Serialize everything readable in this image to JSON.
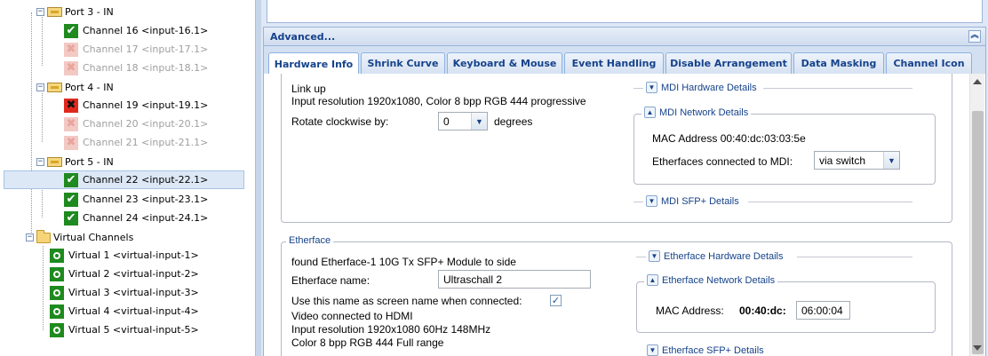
{
  "tree": {
    "ports": [
      {
        "label": "Port 3 - IN",
        "channels": [
          {
            "label": "Channel 16  <input-16.1>",
            "status": "ok"
          },
          {
            "label": "Channel 17  <input-17.1>",
            "status": "off"
          },
          {
            "label": "Channel 18  <input-18.1>",
            "status": "off"
          }
        ]
      },
      {
        "label": "Port 4 - IN",
        "channels": [
          {
            "label": "Channel 19  <input-19.1>",
            "status": "error"
          },
          {
            "label": "Channel 20  <input-20.1>",
            "status": "off"
          },
          {
            "label": "Channel 21  <input-21.1>",
            "status": "off"
          }
        ]
      },
      {
        "label": "Port 5 - IN",
        "channels": [
          {
            "label": "Channel 22  <input-22.1>",
            "status": "ok",
            "selected": true
          },
          {
            "label": "Channel 23  <input-23.1>",
            "status": "ok"
          },
          {
            "label": "Channel 24  <input-24.1>",
            "status": "ok"
          }
        ]
      }
    ],
    "virtual_folder": "Virtual Channels",
    "virtual_items": [
      "Virtual 1  <virtual-input-1>",
      "Virtual 2  <virtual-input-2>",
      "Virtual 3  <virtual-input-3>",
      "Virtual 4  <virtual-input-4>",
      "Virtual 5  <virtual-input-5>"
    ]
  },
  "advanced": {
    "title": "Advanced...",
    "tabs": [
      "Hardware Info",
      "Shrink Curve",
      "Keyboard & Mouse",
      "Event Handling",
      "Disable Arrangement",
      "Data Masking",
      "Channel Icon"
    ],
    "active_tab": "Hardware Info"
  },
  "hardware": {
    "link_status": "Link up",
    "input_resolution": "Input resolution 1920x1080, Color 8 bpp RGB 444 progressive",
    "rotate_label": "Rotate clockwise by:",
    "rotate_value": "0",
    "rotate_unit": "degrees",
    "mdi_hardware_title": "MDI Hardware Details",
    "mdi_network_title": "MDI Network Details",
    "mac_address": "MAC Address 00:40:dc:03:03:5e",
    "etherfaces_label": "Etherfaces connected to MDI:",
    "etherfaces_value": "via switch",
    "mdi_sfp_title": "MDI SFP+ Details"
  },
  "etherface": {
    "legend": "Etherface",
    "found": "found Etherface-1 10G Tx SFP+ Module to side",
    "name_label": "Etherface name:",
    "name_value": "Ultraschall 2",
    "use_name_label": "Use this name as screen name when connected:",
    "use_name_checked": true,
    "video_connected": "Video connected to HDMI",
    "input_resolution": "Input resolution 1920x1080 60Hz 148MHz",
    "color": "Color 8 bpp RGB 444 Full range",
    "hw_title": "Etherface Hardware Details",
    "net_title": "Etherface Network Details",
    "mac_label": "MAC Address:",
    "mac_prefix": "00:40:dc:",
    "mac_suffix": "06:00:04",
    "sfp_title": "Etherface SFP+ Details"
  },
  "colors": {
    "ok": "#1f8a1f",
    "error": "#e0291e",
    "off": "#f3c9c4",
    "header_text": "#15428b",
    "selection": "#dde8f6"
  },
  "icons": {
    "port": "port-icon",
    "folder": "folder-icon",
    "ok": "check-icon",
    "error": "cross-icon",
    "off": "cross-disabled-icon",
    "virtual": "virtual-channel-icon"
  }
}
